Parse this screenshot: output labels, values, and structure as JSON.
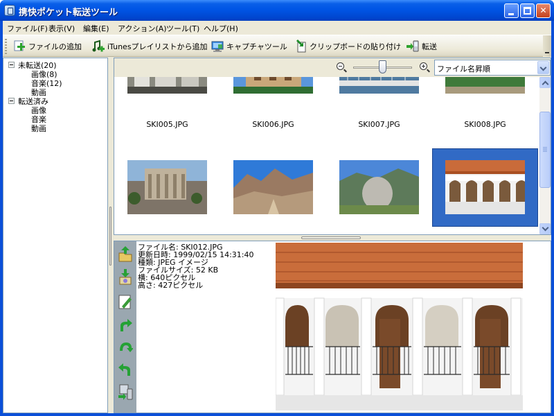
{
  "window": {
    "title": "携快ポケット転送ツール",
    "controls": [
      "minimize",
      "maximize",
      "close"
    ]
  },
  "menu": [
    "ファイル(F)",
    "表示(V)",
    "編集(E)",
    "アクション(A)",
    "ツール(T)",
    "ヘルプ(H)"
  ],
  "toolbar": [
    {
      "label": "ファイルの追加",
      "icon": "add-file-icon"
    },
    {
      "label": "iTunesプレイリストから追加",
      "icon": "add-music-icon"
    },
    {
      "label": "キャプチャツール",
      "icon": "capture-icon"
    },
    {
      "label": "クリップボードの貼り付け",
      "icon": "paste-icon"
    },
    {
      "label": "転送",
      "icon": "transfer-icon"
    }
  ],
  "tree": [
    {
      "label": "未転送(20)",
      "expanded": true,
      "children": [
        "画像(8)",
        "音楽(12)",
        "動画"
      ]
    },
    {
      "label": "転送済み",
      "expanded": true,
      "children": [
        "画像",
        "音楽",
        "動画"
      ]
    }
  ],
  "zoom": {
    "level": 0.5
  },
  "sort": {
    "selected": "ファイル名昇順"
  },
  "thumbnails": {
    "first_row_labels": [
      "SKI005.JPG",
      "SKI006.JPG",
      "SKI007.JPG",
      "SKI008.JPG"
    ],
    "second_row": [
      "ruins",
      "rocky-mountain",
      "boulder",
      "arcade"
    ],
    "selected_index": 3
  },
  "details": {
    "lines": [
      "ファイル名: SKI012.JPG",
      "更新日時: 1999/02/15 14:31:40",
      "種類: JPEG イメージ",
      "ファイルサイズ: 52 KB",
      "横: 640ピクセル",
      "高さ: 427ピクセル"
    ]
  },
  "side_tools": [
    "upload-folder-icon",
    "download-folder-icon",
    "edit-icon",
    "rotate-right-icon",
    "flip-icon",
    "rotate-left-icon",
    "device-transfer-icon"
  ],
  "colors": {
    "selection": "#316ac5",
    "titlebar": "#0055e5",
    "face": "#ece9d8"
  }
}
